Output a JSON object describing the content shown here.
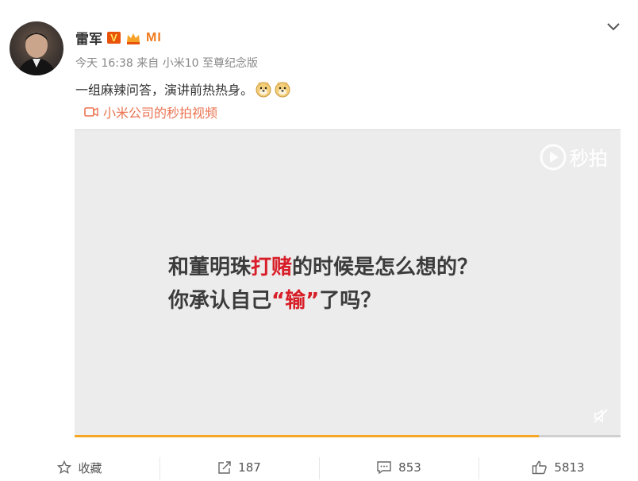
{
  "post": {
    "author": "雷军",
    "badges": {
      "verified": "V",
      "brand": "MI"
    },
    "meta": "今天 16:38 来自 小米10 至尊纪念版",
    "text": "一组麻辣问答，演讲前热热身。",
    "video_source": "小米公司的秒拍视频"
  },
  "video": {
    "watermark": "秒拍",
    "caption_line1": {
      "a": "和董明珠",
      "b": "打赌",
      "c": "的时候是怎么想的？"
    },
    "caption_line2": {
      "a": "你承认自己",
      "b": "“输”",
      "c": "了吗？"
    },
    "progress": 0.85,
    "accent_color": "#d81e28",
    "progress_color": "#f5a623"
  },
  "actions": {
    "favorite_label": "收藏",
    "share_count": "187",
    "comment_count": "853",
    "like_count": "5813"
  },
  "icons": [
    "avatar",
    "crown-icon",
    "chevron-down-icon",
    "doge-emoji",
    "video-icon",
    "miaopai-logo-icon",
    "mute-icon",
    "star-icon",
    "share-icon",
    "comment-icon",
    "thumbs-up-icon"
  ]
}
